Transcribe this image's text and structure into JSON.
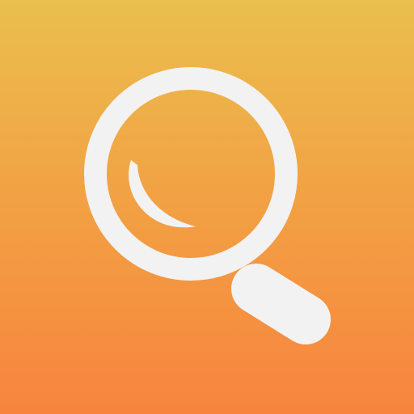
{
  "icon": {
    "name": "magnifying-glass-icon",
    "colors": {
      "gradient_top": "#EABF4E",
      "gradient_mid": "#F2A043",
      "gradient_bottom": "#F7843E",
      "glyph": "#F2F2F2"
    }
  }
}
